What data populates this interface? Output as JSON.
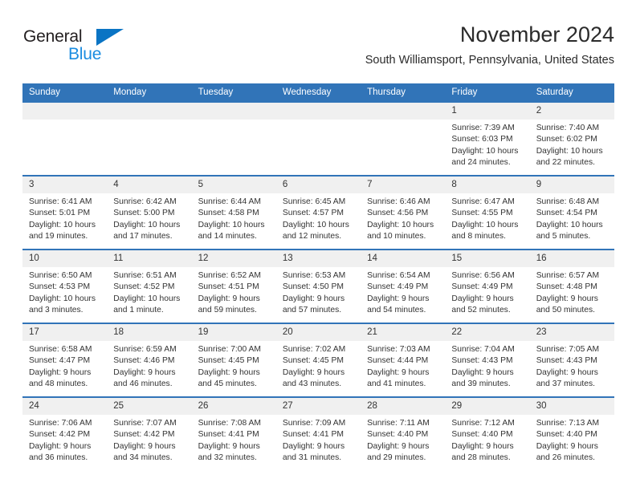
{
  "brand": {
    "name_part1": "General",
    "name_part2": "Blue",
    "triangle_icon": "brand-triangle-icon",
    "accent_dark": "#231f20",
    "accent_blue": "#1a8ce0",
    "triangle_blue": "#0a74c4"
  },
  "header": {
    "month_title": "November 2024",
    "location": "South Williamsport, Pennsylvania, United States"
  },
  "theme": {
    "header_blue": "#3174b8",
    "daynum_band": "#f0f0f0",
    "text": "#333333"
  },
  "weekdays": [
    "Sunday",
    "Monday",
    "Tuesday",
    "Wednesday",
    "Thursday",
    "Friday",
    "Saturday"
  ],
  "weeks": [
    [
      {
        "day": "",
        "sunrise": "",
        "sunset": "",
        "daylight1": "",
        "daylight2": ""
      },
      {
        "day": "",
        "sunrise": "",
        "sunset": "",
        "daylight1": "",
        "daylight2": ""
      },
      {
        "day": "",
        "sunrise": "",
        "sunset": "",
        "daylight1": "",
        "daylight2": ""
      },
      {
        "day": "",
        "sunrise": "",
        "sunset": "",
        "daylight1": "",
        "daylight2": ""
      },
      {
        "day": "",
        "sunrise": "",
        "sunset": "",
        "daylight1": "",
        "daylight2": ""
      },
      {
        "day": "1",
        "sunrise": "Sunrise: 7:39 AM",
        "sunset": "Sunset: 6:03 PM",
        "daylight1": "Daylight: 10 hours",
        "daylight2": "and 24 minutes."
      },
      {
        "day": "2",
        "sunrise": "Sunrise: 7:40 AM",
        "sunset": "Sunset: 6:02 PM",
        "daylight1": "Daylight: 10 hours",
        "daylight2": "and 22 minutes."
      }
    ],
    [
      {
        "day": "3",
        "sunrise": "Sunrise: 6:41 AM",
        "sunset": "Sunset: 5:01 PM",
        "daylight1": "Daylight: 10 hours",
        "daylight2": "and 19 minutes."
      },
      {
        "day": "4",
        "sunrise": "Sunrise: 6:42 AM",
        "sunset": "Sunset: 5:00 PM",
        "daylight1": "Daylight: 10 hours",
        "daylight2": "and 17 minutes."
      },
      {
        "day": "5",
        "sunrise": "Sunrise: 6:44 AM",
        "sunset": "Sunset: 4:58 PM",
        "daylight1": "Daylight: 10 hours",
        "daylight2": "and 14 minutes."
      },
      {
        "day": "6",
        "sunrise": "Sunrise: 6:45 AM",
        "sunset": "Sunset: 4:57 PM",
        "daylight1": "Daylight: 10 hours",
        "daylight2": "and 12 minutes."
      },
      {
        "day": "7",
        "sunrise": "Sunrise: 6:46 AM",
        "sunset": "Sunset: 4:56 PM",
        "daylight1": "Daylight: 10 hours",
        "daylight2": "and 10 minutes."
      },
      {
        "day": "8",
        "sunrise": "Sunrise: 6:47 AM",
        "sunset": "Sunset: 4:55 PM",
        "daylight1": "Daylight: 10 hours",
        "daylight2": "and 8 minutes."
      },
      {
        "day": "9",
        "sunrise": "Sunrise: 6:48 AM",
        "sunset": "Sunset: 4:54 PM",
        "daylight1": "Daylight: 10 hours",
        "daylight2": "and 5 minutes."
      }
    ],
    [
      {
        "day": "10",
        "sunrise": "Sunrise: 6:50 AM",
        "sunset": "Sunset: 4:53 PM",
        "daylight1": "Daylight: 10 hours",
        "daylight2": "and 3 minutes."
      },
      {
        "day": "11",
        "sunrise": "Sunrise: 6:51 AM",
        "sunset": "Sunset: 4:52 PM",
        "daylight1": "Daylight: 10 hours",
        "daylight2": "and 1 minute."
      },
      {
        "day": "12",
        "sunrise": "Sunrise: 6:52 AM",
        "sunset": "Sunset: 4:51 PM",
        "daylight1": "Daylight: 9 hours",
        "daylight2": "and 59 minutes."
      },
      {
        "day": "13",
        "sunrise": "Sunrise: 6:53 AM",
        "sunset": "Sunset: 4:50 PM",
        "daylight1": "Daylight: 9 hours",
        "daylight2": "and 57 minutes."
      },
      {
        "day": "14",
        "sunrise": "Sunrise: 6:54 AM",
        "sunset": "Sunset: 4:49 PM",
        "daylight1": "Daylight: 9 hours",
        "daylight2": "and 54 minutes."
      },
      {
        "day": "15",
        "sunrise": "Sunrise: 6:56 AM",
        "sunset": "Sunset: 4:49 PM",
        "daylight1": "Daylight: 9 hours",
        "daylight2": "and 52 minutes."
      },
      {
        "day": "16",
        "sunrise": "Sunrise: 6:57 AM",
        "sunset": "Sunset: 4:48 PM",
        "daylight1": "Daylight: 9 hours",
        "daylight2": "and 50 minutes."
      }
    ],
    [
      {
        "day": "17",
        "sunrise": "Sunrise: 6:58 AM",
        "sunset": "Sunset: 4:47 PM",
        "daylight1": "Daylight: 9 hours",
        "daylight2": "and 48 minutes."
      },
      {
        "day": "18",
        "sunrise": "Sunrise: 6:59 AM",
        "sunset": "Sunset: 4:46 PM",
        "daylight1": "Daylight: 9 hours",
        "daylight2": "and 46 minutes."
      },
      {
        "day": "19",
        "sunrise": "Sunrise: 7:00 AM",
        "sunset": "Sunset: 4:45 PM",
        "daylight1": "Daylight: 9 hours",
        "daylight2": "and 45 minutes."
      },
      {
        "day": "20",
        "sunrise": "Sunrise: 7:02 AM",
        "sunset": "Sunset: 4:45 PM",
        "daylight1": "Daylight: 9 hours",
        "daylight2": "and 43 minutes."
      },
      {
        "day": "21",
        "sunrise": "Sunrise: 7:03 AM",
        "sunset": "Sunset: 4:44 PM",
        "daylight1": "Daylight: 9 hours",
        "daylight2": "and 41 minutes."
      },
      {
        "day": "22",
        "sunrise": "Sunrise: 7:04 AM",
        "sunset": "Sunset: 4:43 PM",
        "daylight1": "Daylight: 9 hours",
        "daylight2": "and 39 minutes."
      },
      {
        "day": "23",
        "sunrise": "Sunrise: 7:05 AM",
        "sunset": "Sunset: 4:43 PM",
        "daylight1": "Daylight: 9 hours",
        "daylight2": "and 37 minutes."
      }
    ],
    [
      {
        "day": "24",
        "sunrise": "Sunrise: 7:06 AM",
        "sunset": "Sunset: 4:42 PM",
        "daylight1": "Daylight: 9 hours",
        "daylight2": "and 36 minutes."
      },
      {
        "day": "25",
        "sunrise": "Sunrise: 7:07 AM",
        "sunset": "Sunset: 4:42 PM",
        "daylight1": "Daylight: 9 hours",
        "daylight2": "and 34 minutes."
      },
      {
        "day": "26",
        "sunrise": "Sunrise: 7:08 AM",
        "sunset": "Sunset: 4:41 PM",
        "daylight1": "Daylight: 9 hours",
        "daylight2": "and 32 minutes."
      },
      {
        "day": "27",
        "sunrise": "Sunrise: 7:09 AM",
        "sunset": "Sunset: 4:41 PM",
        "daylight1": "Daylight: 9 hours",
        "daylight2": "and 31 minutes."
      },
      {
        "day": "28",
        "sunrise": "Sunrise: 7:11 AM",
        "sunset": "Sunset: 4:40 PM",
        "daylight1": "Daylight: 9 hours",
        "daylight2": "and 29 minutes."
      },
      {
        "day": "29",
        "sunrise": "Sunrise: 7:12 AM",
        "sunset": "Sunset: 4:40 PM",
        "daylight1": "Daylight: 9 hours",
        "daylight2": "and 28 minutes."
      },
      {
        "day": "30",
        "sunrise": "Sunrise: 7:13 AM",
        "sunset": "Sunset: 4:40 PM",
        "daylight1": "Daylight: 9 hours",
        "daylight2": "and 26 minutes."
      }
    ]
  ]
}
